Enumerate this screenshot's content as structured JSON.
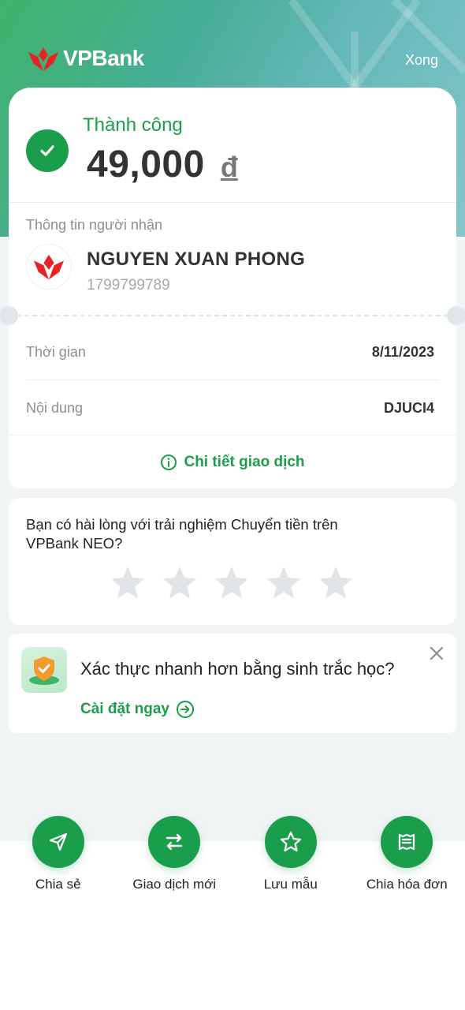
{
  "header": {
    "brand": "VPBank",
    "done_label": "Xong"
  },
  "status": {
    "text": "Thành công",
    "amount": "49,000",
    "currency": "đ"
  },
  "recipient": {
    "section_label": "Thông tin người nhận",
    "name": "NGUYEN XUAN PHONG",
    "account": "1799799789"
  },
  "details": {
    "time_label": "Thời gian",
    "time_value": "8/11/2023",
    "note_label": "Nội dung",
    "note_value": "DJUCI4",
    "detail_link": "Chi tiết giao dịch"
  },
  "rating": {
    "question": "Bạn có hài lòng với trải nghiệm Chuyển tiền trên VPBank NEO?",
    "stars_total": 5,
    "stars_selected": 0
  },
  "biometric": {
    "title": "Xác thực nhanh hơn bằng sinh trắc học?",
    "cta": "Cài đặt ngay"
  },
  "actions": [
    {
      "label": "Chia sẻ",
      "icon": "send-icon"
    },
    {
      "label": "Giao dịch mới",
      "icon": "swap-icon"
    },
    {
      "label": "Lưu mẫu",
      "icon": "star-icon"
    },
    {
      "label": "Chia hóa đơn",
      "icon": "receipt-icon"
    }
  ],
  "colors": {
    "primary": "#1a9e4b",
    "brand_red": "#e42524",
    "star_inactive": "#e2e5e8"
  }
}
